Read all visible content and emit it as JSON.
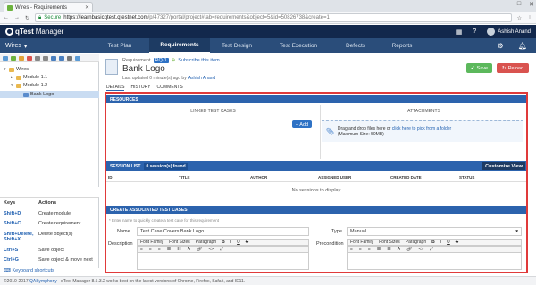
{
  "browser": {
    "tab_title": "Wires - Requirements",
    "secure_label": "Secure",
    "url_host": "https://learnbasicqtest.qtestnet.com",
    "url_path": "/p/47327/portal/project#tab=requirements&object=5&id=50826738&create=1"
  },
  "app": {
    "logo_text": "qTest",
    "logo_suffix": "Manager",
    "user": "Ashish Anand"
  },
  "nav": {
    "project": "Wires",
    "tabs": [
      "Test Plan",
      "Requirements",
      "Test Design",
      "Test Execution",
      "Defects",
      "Reports"
    ],
    "active": "Requirements"
  },
  "tree": {
    "root": "Wires",
    "items": [
      "Module 1.1",
      "Module 1.2",
      "Bank Logo"
    ]
  },
  "keys": {
    "header_key": "Keys",
    "header_action": "Actions",
    "rows": [
      {
        "k": "Shift+D",
        "a": "Create module"
      },
      {
        "k": "Shift+C",
        "a": "Create requirement"
      },
      {
        "k": "Shift+Delete, Shift+X",
        "a": "Delete object(s)"
      },
      {
        "k": "Ctrl+S",
        "a": "Save object"
      },
      {
        "k": "Ctrl+G",
        "a": "Save object & move next"
      }
    ],
    "shortcut_link": "Keyboard shortcuts"
  },
  "req": {
    "label": "Requirement",
    "id": "RQ-1",
    "subscribe": "Subscribe this item",
    "title": "Bank Logo",
    "updated": "Last updated 0 minute(s) ago by",
    "updated_by": "Ashish Anand",
    "save": "Save",
    "reload": "Reload",
    "subtabs": [
      "DETAILS",
      "HISTORY",
      "COMMENTS"
    ]
  },
  "resources": {
    "header": "RESOURCES",
    "linked": "LINKED TEST CASES",
    "attachments": "ATTACHMENTS",
    "add": "+ Add",
    "drop_text": "Drag and drop files here or",
    "drop_link": "click here to pick from a folder",
    "max_size": "(Maximum Size: 50MB)"
  },
  "sessions": {
    "header": "SESSION LIST",
    "count": "0 session(s) found",
    "customize": "Customize View",
    "columns": [
      "ID",
      "TITLE",
      "AUTHOR",
      "ASSIGNED USER",
      "CREATED DATE",
      "STATUS"
    ],
    "empty": "No sessions to display"
  },
  "assoc": {
    "header": "CREATE ASSOCIATED TEST CASES",
    "hint": "* Enter name to quickly create a test case for this requirement",
    "name_label": "Name",
    "name_value": "Test Case Covers Bank Logo",
    "type_label": "Type",
    "type_value": "Manual",
    "desc_label": "Description",
    "precond_label": "Precondition",
    "toolbar": [
      "Font Family",
      "Font Sizes",
      "Paragraph",
      "B",
      "I",
      "U",
      "S"
    ]
  },
  "footer": {
    "copy": "©2010-2017",
    "company": "QASymphony",
    "text": "qTest Manager 8.5.3.2 works best on the latest versions of Chrome, Firefox, Safari, and IE11."
  },
  "colors": {
    "accent": "#2c63ad",
    "header": "#12284c",
    "nav": "#2a4d7a",
    "save": "#5cb85c",
    "reload": "#d9534f",
    "highlight": "#e03a3a"
  }
}
